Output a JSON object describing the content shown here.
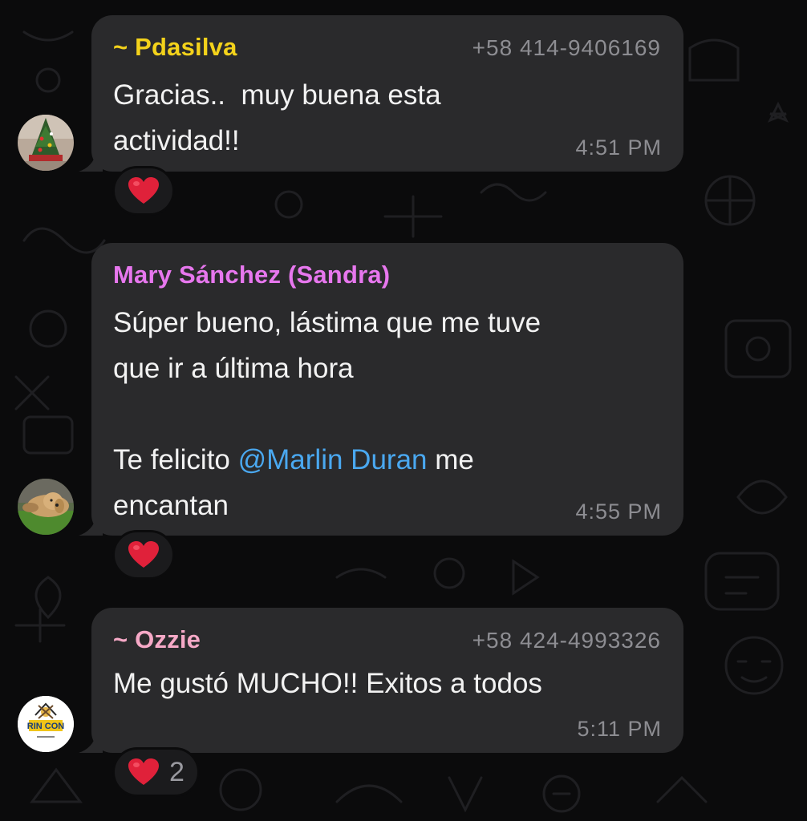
{
  "colors": {
    "background": "#0b0b0c",
    "bubble": "#2a2a2c",
    "meta_text": "#8d8d92",
    "mention": "#4aa8f0",
    "heart": "#e0213a"
  },
  "messages": [
    {
      "sender": "~ Pdasilva",
      "sender_color": "#f3d21b",
      "phone": "+58 414-9406169",
      "text": "Gracias..  muy buena esta\nactividad!!",
      "time": "4:51 PM",
      "reaction": {
        "emoji": "heart",
        "count": ""
      },
      "avatar": "christmas-tree-avatar"
    },
    {
      "sender": "Mary Sánchez (Sandra)",
      "sender_color": "#e777ee",
      "phone": "",
      "text_before_mention": "Súper bueno, lástima que me tuve\nque ir a última hora\n\nTe felicito ",
      "mention": "@Marlin Duran",
      "text_after_mention": " me\nencantan",
      "time": "4:55 PM",
      "reaction": {
        "emoji": "heart",
        "count": ""
      },
      "avatar": "dog-avatar"
    },
    {
      "sender": "~ Ozzie",
      "sender_color": "#f6a9c7",
      "phone": "+58 424-4993326",
      "text": "Me gustó MUCHO!! Exitos a todos",
      "time": "5:11 PM",
      "reaction": {
        "emoji": "heart",
        "count": "2"
      },
      "avatar": "rincon-logo-avatar",
      "avatar_logo_text": "RIN CON"
    }
  ]
}
